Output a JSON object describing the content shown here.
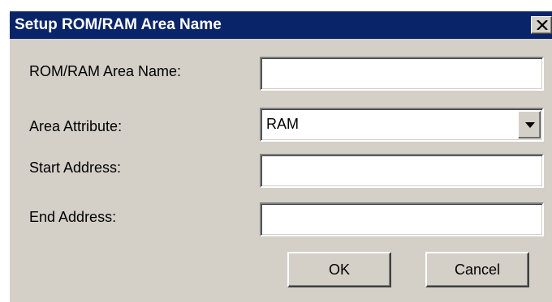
{
  "dialog": {
    "title": "Setup ROM/RAM Area Name",
    "close_icon": "close-icon"
  },
  "fields": {
    "area_name": {
      "label": "ROM/RAM Area Name:",
      "value": ""
    },
    "area_attribute": {
      "label": "Area Attribute:",
      "value": "RAM"
    },
    "start_address": {
      "label": "Start Address:",
      "value": ""
    },
    "end_address": {
      "label": "End Address:",
      "value": ""
    }
  },
  "buttons": {
    "ok": "OK",
    "cancel": "Cancel"
  },
  "colors": {
    "titlebar": "#0a246a",
    "face": "#d4d0c8"
  }
}
